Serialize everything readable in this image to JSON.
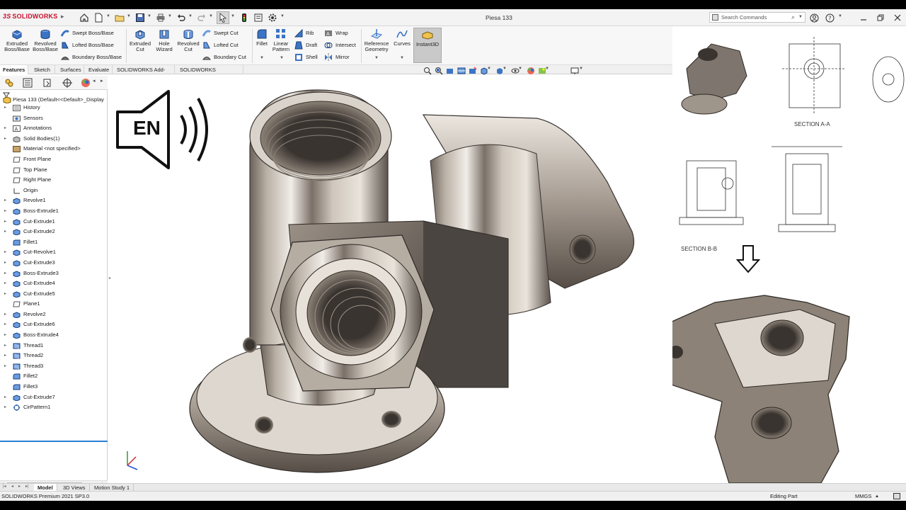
{
  "app": {
    "logo_text": "SOLIDWORKS",
    "document_title": "Piesa 133",
    "search_placeholder": "Search Commands"
  },
  "ribbon": {
    "buttons": [
      {
        "id": "extruded-boss",
        "label1": "Extruded",
        "label2": "Boss/Base"
      },
      {
        "id": "revolved-boss",
        "label1": "Revolved",
        "label2": "Boss/Base"
      },
      {
        "id": "extruded-cut",
        "label1": "Extruded",
        "label2": "Cut"
      },
      {
        "id": "hole-wizard",
        "label1": "Hole",
        "label2": "Wizard"
      },
      {
        "id": "revolved-cut",
        "label1": "Revolved",
        "label2": "Cut"
      },
      {
        "id": "fillet",
        "label1": "Fillet",
        "label2": ""
      },
      {
        "id": "linear-pattern",
        "label1": "Linear",
        "label2": "Pattern"
      },
      {
        "id": "reference-geometry",
        "label1": "Reference",
        "label2": "Geometry"
      },
      {
        "id": "curves",
        "label1": "Curves",
        "label2": ""
      }
    ],
    "small": {
      "swept_boss": "Swept Boss/Base",
      "lofted_boss": "Lofted Boss/Base",
      "boundary_boss": "Boundary Boss/Base",
      "swept_cut": "Swept Cut",
      "lofted_cut": "Lofted Cut",
      "boundary_cut": "Boundary Cut",
      "rib": "Rib",
      "draft": "Draft",
      "shell": "Shell",
      "wrap": "Wrap",
      "intersect": "Intersect",
      "mirror": "Mirror"
    },
    "instant3d": "Instant3D"
  },
  "command_tabs": [
    "Features",
    "Sketch",
    "Surfaces",
    "Evaluate",
    "SOLIDWORKS Add-Ins",
    "SOLIDWORKS Inspection"
  ],
  "feature_tree": {
    "root": "Piesa 133  (Default<<Default>_Display",
    "items": [
      {
        "label": "History",
        "icon": "history"
      },
      {
        "label": "Sensors",
        "icon": "sensor"
      },
      {
        "label": "Annotations",
        "icon": "annotation"
      },
      {
        "label": "Solid Bodies(1)",
        "icon": "solid"
      },
      {
        "label": "Material <not specified>",
        "icon": "material"
      },
      {
        "label": "Front Plane",
        "icon": "plane"
      },
      {
        "label": "Top Plane",
        "icon": "plane"
      },
      {
        "label": "Right Plane",
        "icon": "plane"
      },
      {
        "label": "Origin",
        "icon": "origin"
      },
      {
        "label": "Revolve1",
        "icon": "feature"
      },
      {
        "label": "Boss-Extrude1",
        "icon": "feature"
      },
      {
        "label": "Cut-Extrude1",
        "icon": "feature"
      },
      {
        "label": "Cut-Extrude2",
        "icon": "feature"
      },
      {
        "label": "Fillet1",
        "icon": "fillet"
      },
      {
        "label": "Cut-Revolve1",
        "icon": "feature"
      },
      {
        "label": "Cut-Extrude3",
        "icon": "feature"
      },
      {
        "label": "Boss-Extrude3",
        "icon": "feature"
      },
      {
        "label": "Cut-Extrude4",
        "icon": "feature"
      },
      {
        "label": "Cut-Extrude5",
        "icon": "feature"
      },
      {
        "label": "Plane1",
        "icon": "plane"
      },
      {
        "label": "Revolve2",
        "icon": "feature"
      },
      {
        "label": "Cut-Extrude6",
        "icon": "feature"
      },
      {
        "label": "Boss-Extrude4",
        "icon": "feature"
      },
      {
        "label": "Thread1",
        "icon": "thread"
      },
      {
        "label": "Thread2",
        "icon": "thread"
      },
      {
        "label": "Thread3",
        "icon": "thread"
      },
      {
        "label": "Fillet2",
        "icon": "fillet"
      },
      {
        "label": "Fillet3",
        "icon": "fillet"
      },
      {
        "label": "Cut-Extrude7",
        "icon": "feature"
      },
      {
        "label": "CirPattern1",
        "icon": "pattern"
      }
    ]
  },
  "overlay": {
    "language_badge": "EN",
    "drawing_labels": {
      "section_a": "SECTION A-A",
      "section_b": "SECTION B-B"
    }
  },
  "bottom_tabs": [
    "Model",
    "3D Views",
    "Motion Study 1"
  ],
  "status": {
    "product": "SOLIDWORKS Premium 2021 SP3.0",
    "mode": "Editing Part",
    "units": "MMGS"
  },
  "colors": {
    "accent": "#2a7fd4",
    "brand_red": "#c8102e",
    "metal_light": "#e6e1da",
    "metal_dark": "#4a4540"
  }
}
